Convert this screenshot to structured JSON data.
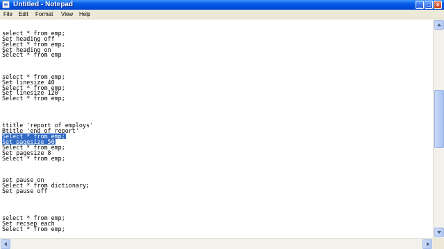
{
  "window": {
    "title": "Untitled - Notepad"
  },
  "menu": [
    "File",
    "Edit",
    "Format",
    "View",
    "Help"
  ],
  "editor": {
    "lines": [
      "select * from emp;",
      "Set heading off",
      "Select * from emp;",
      "Set heading on",
      "Select * from emp",
      "",
      "",
      "",
      "select * from emp;",
      "Set linesize 40",
      "Select * from emp;",
      "Set linesize 120",
      "Select * from emp;",
      "",
      "",
      "",
      "",
      "ttitle 'report of employs'",
      "Btitle 'end of report'",
      "Select * from emp;",
      "Set pagesize 50",
      "Select * from emp;",
      "Set pagesize 8",
      "Select * from emp;",
      "",
      "",
      "",
      "set pause on",
      "Select * from dictionary;",
      "Set pause off",
      "",
      "",
      "",
      "",
      "select * from emp;",
      "Set recsep each",
      "Select * from emp;"
    ],
    "selected_lines": [
      19,
      20
    ],
    "selection_color": "#316AC5"
  },
  "colors": {
    "titlebar": "#0054E3",
    "window_bg": "#ECE9D8",
    "editor_bg": "#FFFFFF"
  },
  "icons": {
    "app": "notepad-icon",
    "minimize": "minimize-icon",
    "maximize": "maximize-icon",
    "close": "close-icon"
  }
}
